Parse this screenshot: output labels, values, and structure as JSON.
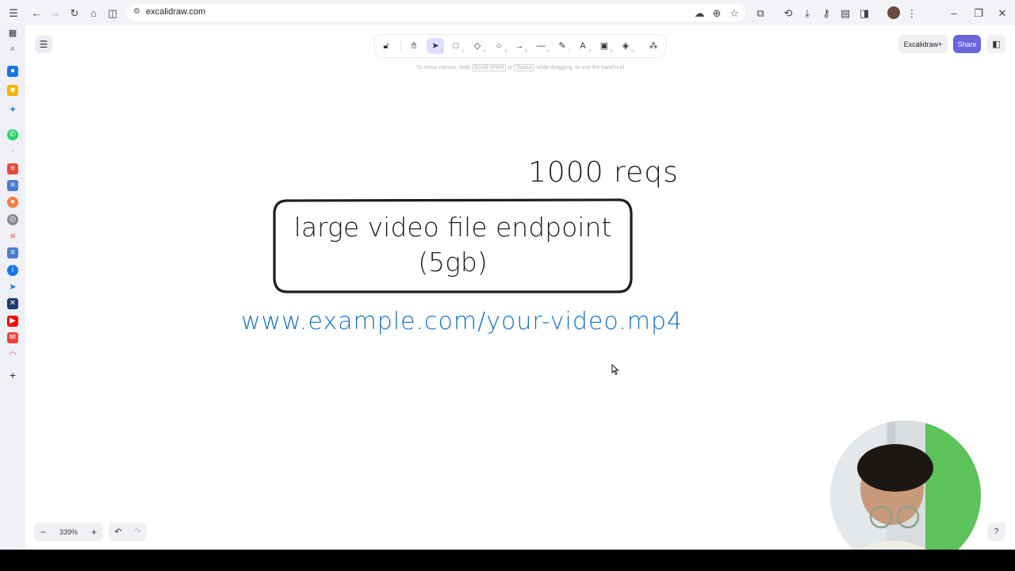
{
  "browser": {
    "url": "excalidraw.com"
  },
  "canvas_hint": {
    "prefix": "To move canvas, hold",
    "key1": "Scroll wheel",
    "middle": "or",
    "key2": "Space",
    "suffix": "while dragging, or use the hand tool"
  },
  "header": {
    "plus_label": "Excalidraw+",
    "share_label": "Share"
  },
  "drawing": {
    "reqs_text": "1000 reqs",
    "box_line1": "large video file endpoint",
    "box_line2": "(5gb)",
    "url_text": "www.example.com/your-video.mp4",
    "url_color": "#1971c2"
  },
  "footer": {
    "zoom_level": "339%"
  },
  "toolbar": {
    "tools": [
      {
        "name": "lock-icon",
        "glyph": "🔓︎",
        "shortcut": ""
      },
      {
        "name": "hand-icon",
        "glyph": "✋︎",
        "shortcut": ""
      },
      {
        "name": "selection-icon",
        "glyph": "➤",
        "shortcut": "1"
      },
      {
        "name": "rectangle-icon",
        "glyph": "□",
        "shortcut": "2"
      },
      {
        "name": "diamond-icon",
        "glyph": "◇",
        "shortcut": "3"
      },
      {
        "name": "ellipse-icon",
        "glyph": "○",
        "shortcut": "4"
      },
      {
        "name": "arrow-icon",
        "glyph": "→",
        "shortcut": "5"
      },
      {
        "name": "line-icon",
        "glyph": "—",
        "shortcut": "6"
      },
      {
        "name": "pencil-icon",
        "glyph": "✎",
        "shortcut": "7"
      },
      {
        "name": "text-icon",
        "glyph": "A",
        "shortcut": "8"
      },
      {
        "name": "image-icon",
        "glyph": "▣",
        "shortcut": "9"
      },
      {
        "name": "eraser-icon",
        "glyph": "◈",
        "shortcut": "0"
      },
      {
        "name": "extra-tools-icon",
        "glyph": "⁂",
        "shortcut": ""
      }
    ],
    "active_tool": "selection-icon",
    "accent_color": "#6965db"
  }
}
